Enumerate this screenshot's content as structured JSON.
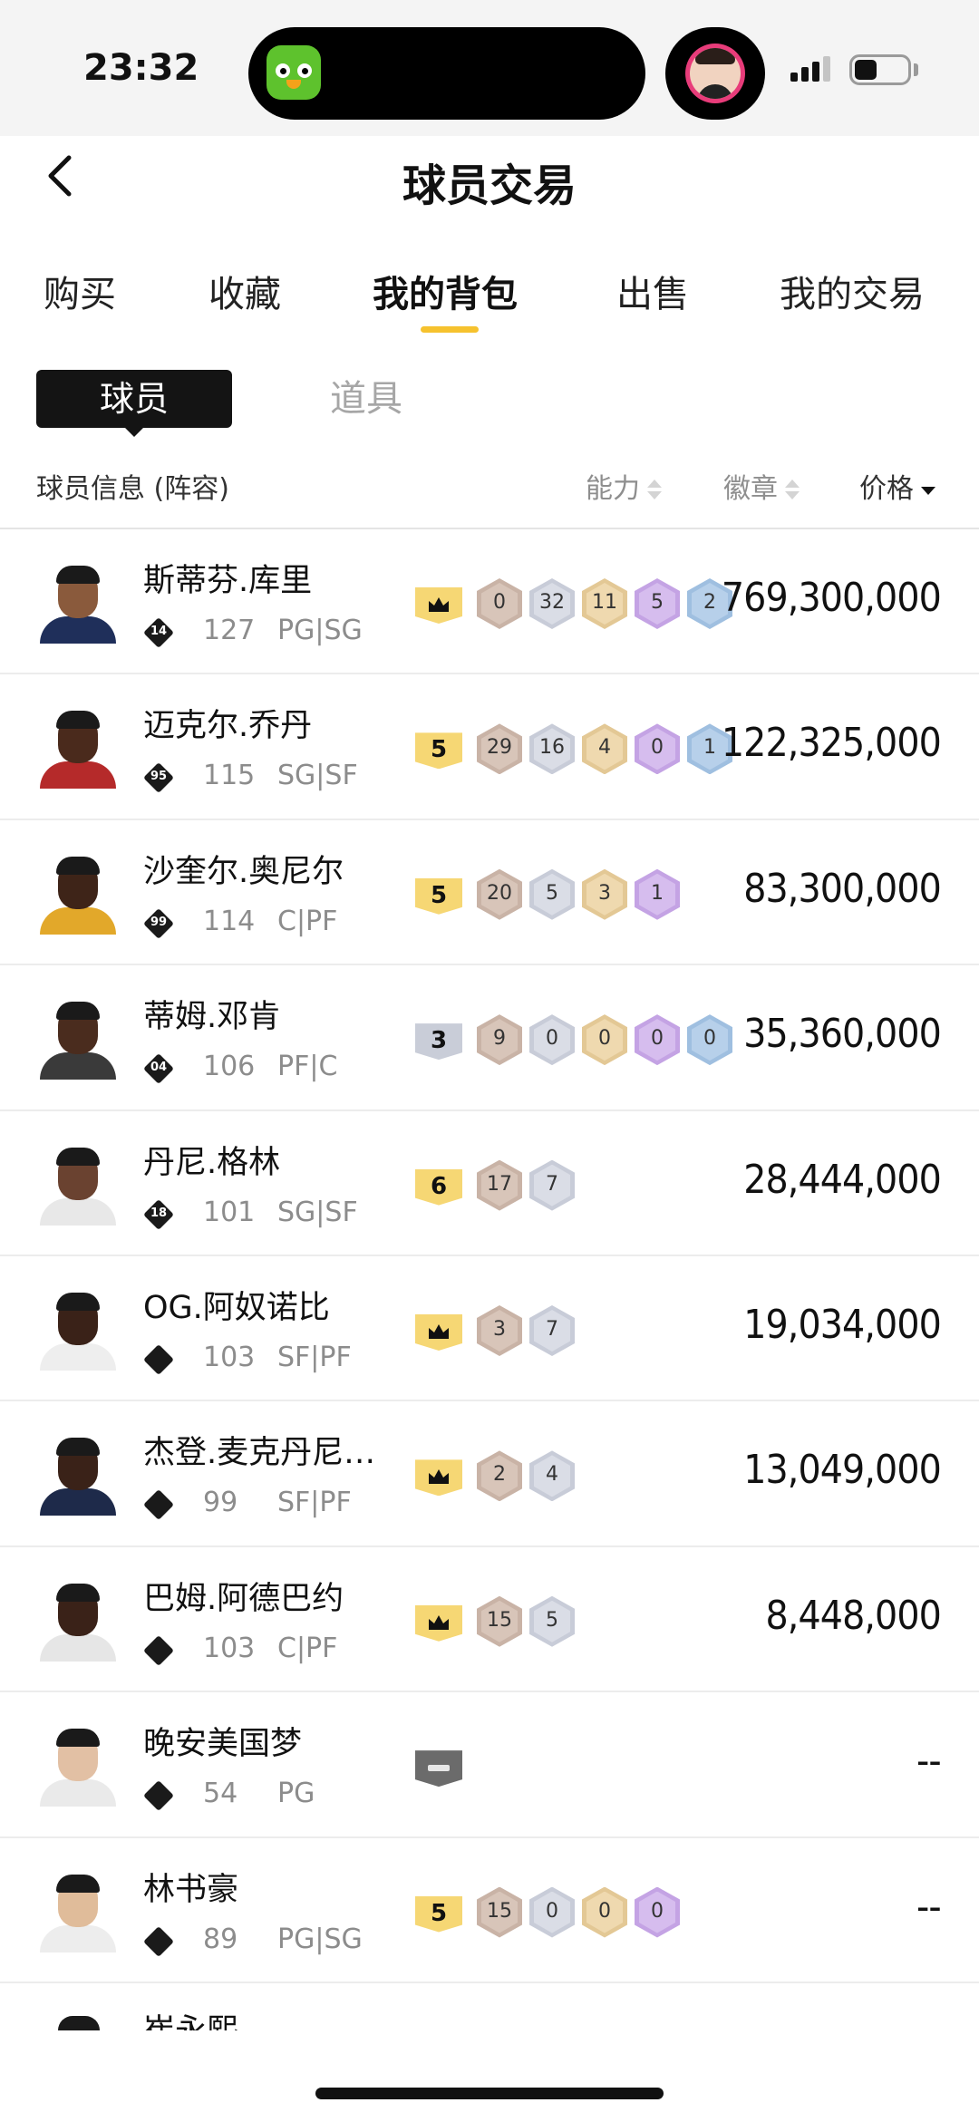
{
  "status_bar": {
    "time": "23:32"
  },
  "header": {
    "title": "球员交易"
  },
  "tabs": [
    {
      "label": "购买",
      "active": false
    },
    {
      "label": "收藏",
      "active": false
    },
    {
      "label": "我的背包",
      "active": true
    },
    {
      "label": "出售",
      "active": false
    },
    {
      "label": "我的交易",
      "active": false
    }
  ],
  "segments": {
    "players": "球员",
    "items": "道具",
    "selected": "球员"
  },
  "columns": {
    "info": "球员信息 (阵容)",
    "ability": "能力",
    "badges": "徽章",
    "price": "价格",
    "sorted_by": "价格"
  },
  "colors": {
    "accent": "#f6c22e",
    "tier_gold": "#f6d774",
    "tier_silver": "#c9cdd8",
    "tier_grey": "#6b6b6b",
    "hex_bronze": "#c9b3a6",
    "hex_silver": "#c8ccd8",
    "hex_gold": "#e3c895",
    "hex_purple": "#c4a3e4",
    "hex_blue": "#9fbfe0"
  },
  "players": [
    {
      "name": "斯蒂芬.库里",
      "rank": "14",
      "ovr": "127",
      "pos": "PG|SG",
      "tier": "crown",
      "badges": [
        "0",
        "32",
        "11",
        "5",
        "2"
      ],
      "price": "769,300,000",
      "jersey": "#1f2f5a",
      "skin": "#8a5a3c"
    },
    {
      "name": "迈克尔.乔丹",
      "rank": "95",
      "ovr": "115",
      "pos": "SG|SF",
      "tier": "5",
      "badges": [
        "29",
        "16",
        "4",
        "0",
        "1"
      ],
      "price": "122,325,000",
      "jersey": "#b52a2a",
      "skin": "#4a2a1c"
    },
    {
      "name": "沙奎尔.奥尼尔",
      "rank": "99",
      "ovr": "114",
      "pos": "C|PF",
      "tier": "5",
      "badges": [
        "20",
        "5",
        "3",
        "1"
      ],
      "price": "83,300,000",
      "jersey": "#e2a82a",
      "skin": "#3e2418"
    },
    {
      "name": "蒂姆.邓肯",
      "rank": "04",
      "ovr": "106",
      "pos": "PF|C",
      "tier": "3",
      "badges": [
        "9",
        "0",
        "0",
        "0",
        "0"
      ],
      "price": "35,360,000",
      "jersey": "#3a3a3a",
      "skin": "#4a2c1e"
    },
    {
      "name": "丹尼.格林",
      "rank": "18",
      "ovr": "101",
      "pos": "SG|SF",
      "tier": "6",
      "badges": [
        "17",
        "7"
      ],
      "price": "28,444,000",
      "jersey": "#e8e8e8",
      "skin": "#6a4230"
    },
    {
      "name": "OG.阿奴诺比",
      "rank": "",
      "ovr": "103",
      "pos": "SF|PF",
      "tier": "crown",
      "badges": [
        "3",
        "7"
      ],
      "price": "19,034,000",
      "jersey": "#eeeeee",
      "skin": "#3a2218"
    },
    {
      "name": "杰登.麦克丹尼…",
      "rank": "",
      "ovr": "99",
      "pos": "SF|PF",
      "tier": "crown",
      "badges": [
        "2",
        "4"
      ],
      "price": "13,049,000",
      "jersey": "#1e2a4a",
      "skin": "#3a2218"
    },
    {
      "name": "巴姆.阿德巴约",
      "rank": "",
      "ovr": "103",
      "pos": "C|PF",
      "tier": "crown",
      "badges": [
        "15",
        "5"
      ],
      "price": "8,448,000",
      "jersey": "#e6e6e6",
      "skin": "#3a2218"
    },
    {
      "name": "晚安美国梦",
      "rank": "",
      "ovr": "54",
      "pos": "PG",
      "tier": "none",
      "badges": [],
      "price": "--",
      "jersey": "#eaeaea",
      "skin": "#e2c0a4"
    },
    {
      "name": "林书豪",
      "rank": "",
      "ovr": "89",
      "pos": "PG|SG",
      "tier": "5",
      "badges": [
        "15",
        "0",
        "0",
        "0"
      ],
      "price": "--",
      "jersey": "#ededed",
      "skin": "#e0bc9a"
    }
  ],
  "partial_row": {
    "name": "崔永熙"
  }
}
